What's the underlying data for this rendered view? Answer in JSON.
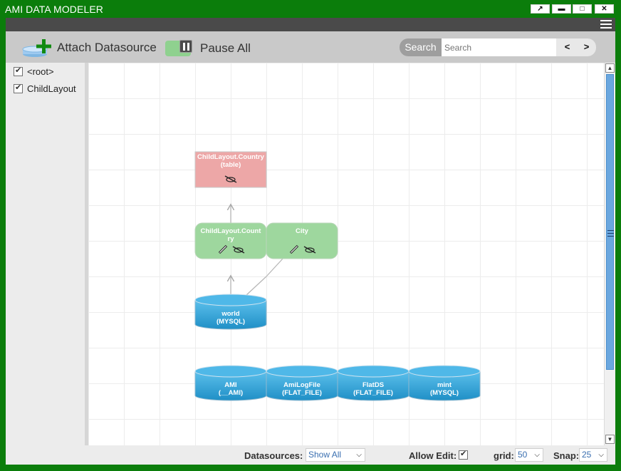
{
  "window": {
    "title": "AMI DATA MODELER",
    "controls": [
      {
        "name": "popout-button",
        "glyph": "↗"
      },
      {
        "name": "minimize-button",
        "glyph": "▬"
      },
      {
        "name": "maximize-button",
        "glyph": "□"
      },
      {
        "name": "close-button",
        "glyph": "✕"
      }
    ]
  },
  "toolbar": {
    "attach_label": "Attach Datasource",
    "pause_label": "Pause All",
    "search_button": "Search",
    "search_placeholder": "Search",
    "prev_label": "<",
    "next_label": ">"
  },
  "tree": {
    "items": [
      {
        "label": "<root>",
        "checked": true
      },
      {
        "label": "ChildLayout",
        "checked": true
      }
    ]
  },
  "graph": {
    "tables": [
      {
        "line1": "ChildLayout.Country",
        "line2": "(table)",
        "color": "#eda7a7"
      }
    ],
    "feeds": [
      {
        "line1": "ChildLayout.Count",
        "line2": "ry",
        "color": "#9ed79e"
      },
      {
        "line1": "City",
        "line2": "",
        "color": "#9ed79e"
      }
    ],
    "datasources": [
      {
        "line1": "world",
        "line2": "(MYSQL)"
      },
      {
        "line1": "AMI",
        "line2": "(__AMI)"
      },
      {
        "line1": "AmiLogFile",
        "line2": "(FLAT_FILE)"
      },
      {
        "line1": "FlatDS",
        "line2": "(FLAT_FILE)"
      },
      {
        "line1": "mint",
        "line2": "(MYSQL)"
      }
    ]
  },
  "statusbar": {
    "datasources_label": "Datasources:",
    "datasources_value": "Show All",
    "allow_edit_label": "Allow Edit:",
    "allow_edit_checked": true,
    "grid_label": "grid:",
    "grid_value": "50",
    "snap_label": "Snap:",
    "snap_value": "25"
  },
  "colors": {
    "window_border": "#0b7d0b",
    "datasource_blue": "#3aa6d8",
    "feed_green": "#9ed79e",
    "table_red": "#eda7a7"
  }
}
